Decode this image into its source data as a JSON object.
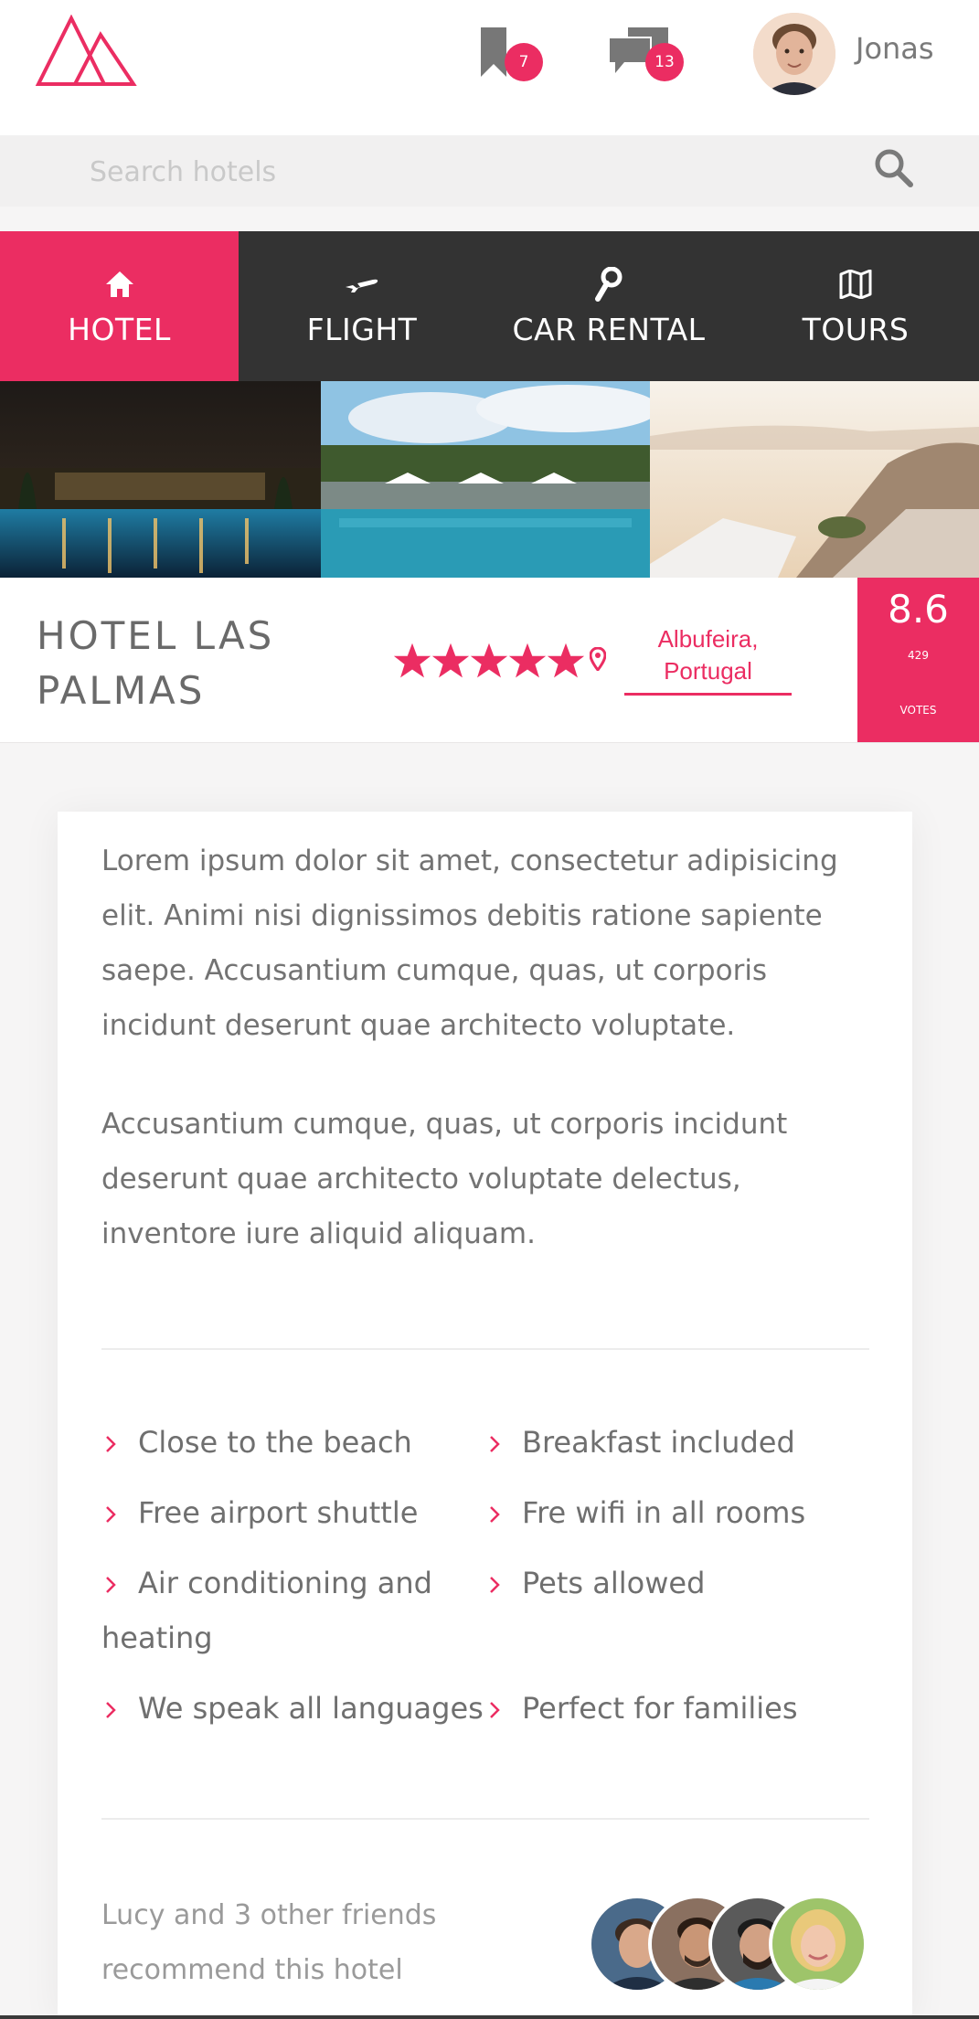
{
  "header": {
    "bookmark_count": "7",
    "message_count": "13",
    "user_name": "Jonas"
  },
  "search": {
    "placeholder": "Search hotels",
    "value": ""
  },
  "tabs": [
    {
      "label": "HOTEL",
      "icon": "home-icon",
      "active": true
    },
    {
      "label": "FLIGHT",
      "icon": "airplane-icon",
      "active": false
    },
    {
      "label": "CAR RENTAL",
      "icon": "key-icon",
      "active": false
    },
    {
      "label": "TOURS",
      "icon": "map-icon",
      "active": false
    }
  ],
  "hotel": {
    "name": "HOTEL LAS PALMAS",
    "stars": 5,
    "location": "Albufeira, Portugal",
    "rating": "8.6",
    "votes_count": "429",
    "votes_label": "VOTES"
  },
  "description": {
    "paragraph1": "Lorem ipsum dolor sit amet, consectetur adipisicing elit. Animi nisi dignissimos debitis ratione sapiente saepe. Accusantium cumque, quas, ut corporis incidunt deserunt quae architecto voluptate.",
    "paragraph2": "Accusantium cumque, quas, ut corporis incidunt deserunt quae architecto voluptate delectus, inventore iure aliquid aliquam."
  },
  "features": [
    "Close to the beach",
    "Breakfast included",
    "Free airport shuttle",
    "Fre wifi in all rooms",
    "Air conditioning and heating",
    "Pets allowed",
    "We speak all languages",
    "Perfect for families"
  ],
  "recommend": {
    "text": "Lucy and 3 other friends recommend this hotel"
  },
  "colors": {
    "accent": "#eb2d62",
    "dark": "#333333"
  }
}
